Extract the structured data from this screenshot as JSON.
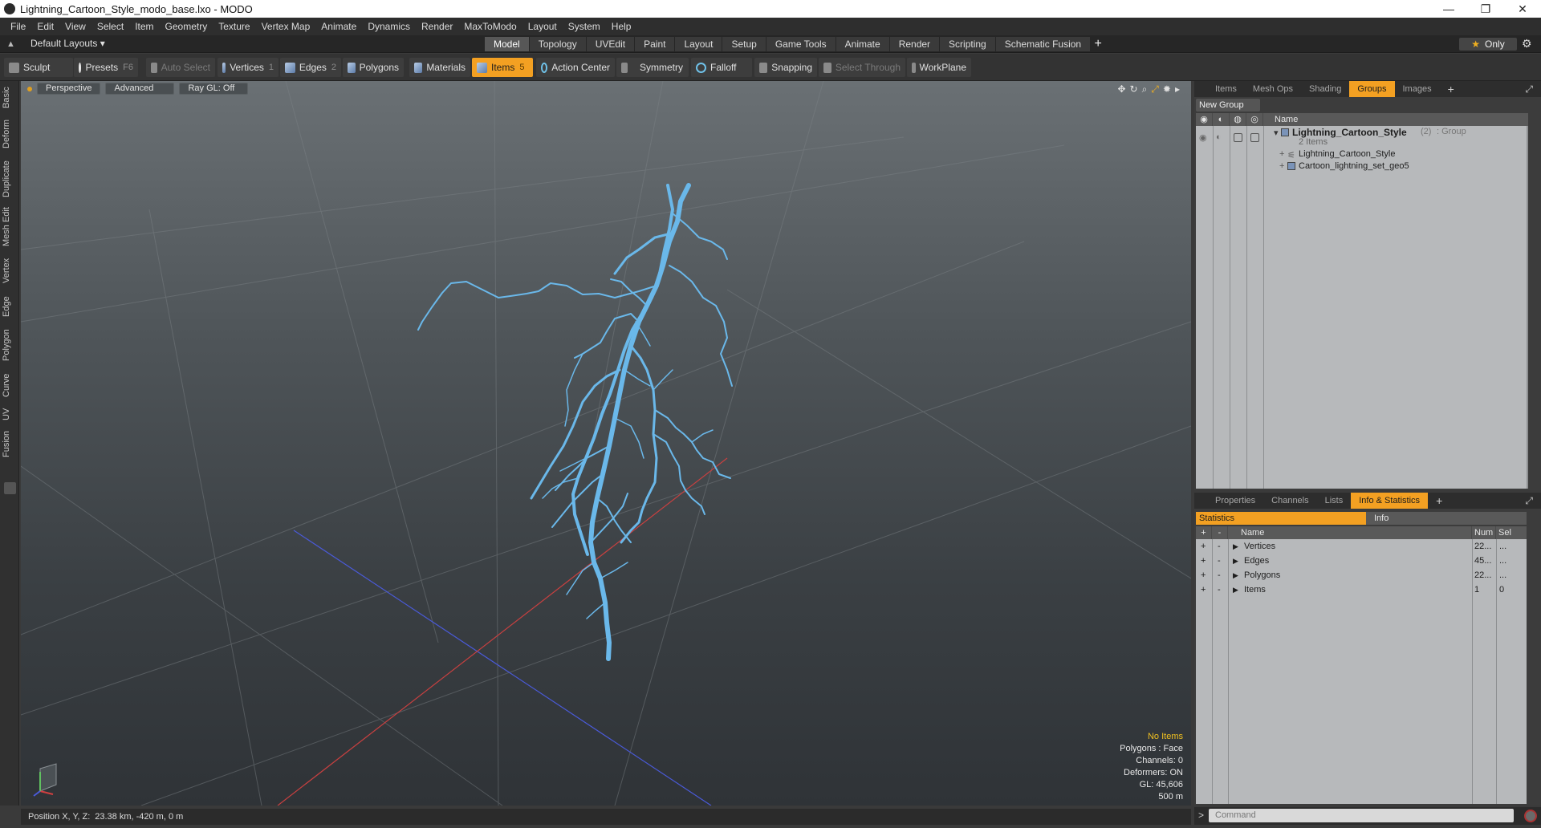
{
  "window": {
    "title": "Lightning_Cartoon_Style_modo_base.lxo - MODO",
    "minimize": "—",
    "maximize": "❐",
    "close": "✕"
  },
  "menu": [
    "File",
    "Edit",
    "View",
    "Select",
    "Item",
    "Geometry",
    "Texture",
    "Vertex Map",
    "Animate",
    "Dynamics",
    "Render",
    "MaxToModo",
    "Layout",
    "System",
    "Help"
  ],
  "layoutbar": {
    "layout_label": "Default Layouts ▾",
    "tabs": [
      "Model",
      "Topology",
      "UVEdit",
      "Paint",
      "Layout",
      "Setup",
      "Game Tools",
      "Animate",
      "Render",
      "Scripting",
      "Schematic Fusion"
    ],
    "active_tab": "Model",
    "plus": "+",
    "only_label": "Only",
    "star": "★",
    "gear": "⚙"
  },
  "toolbar": {
    "sculpt": "Sculpt",
    "presets": "Presets",
    "presets_key": "F6",
    "auto_select": "Auto Select",
    "vertices": "Vertices",
    "vertices_key": "1",
    "edges": "Edges",
    "edges_key": "2",
    "polygons": "Polygons",
    "materials": "Materials",
    "items": "Items",
    "items_key": "5",
    "action_center": "Action Center",
    "symmetry": "Symmetry",
    "falloff": "Falloff",
    "snapping": "Snapping",
    "select_through": "Select Through",
    "workplane": "WorkPlane"
  },
  "left_tabs": [
    "Basic",
    "Deform",
    "Duplicate",
    "Mesh Edit",
    "Vertex",
    "Edge",
    "Polygon",
    "Curve",
    "UV",
    "Fusion"
  ],
  "viewport": {
    "view_mode": "Perspective",
    "shading": "Advanced",
    "raygl": "Ray GL: Off",
    "info": {
      "no_items": "No Items",
      "polygons": "Polygons : Face",
      "channels": "Channels: 0",
      "deformers": "Deformers: ON",
      "gl": "GL: 45,606",
      "scale": "500 m"
    },
    "axis_colors": {
      "x": "#d04040",
      "y": "#60c060",
      "z": "#4a5ad8"
    },
    "bolt_color": "#6ab8ea"
  },
  "statusbar": {
    "label": "Position X, Y, Z:",
    "value": "23.38 km, -420 m, 0 m"
  },
  "groups_panel": {
    "tabs": [
      "Items",
      "Mesh Ops",
      "Shading",
      "Groups",
      "Images"
    ],
    "active_tab": "Groups",
    "plus": "+",
    "new_group": "New Group",
    "header_name": "Name",
    "group": {
      "name": "Lightning_Cartoon_Style",
      "count": "(2)",
      "type": ": Group",
      "items_count": "2 Items"
    },
    "children": [
      "Lightning_Cartoon_Style",
      "Cartoon_lightning_set_geo5"
    ]
  },
  "stats_panel": {
    "tabs": [
      "Properties",
      "Channels",
      "Lists",
      "Info & Statistics"
    ],
    "active_tab": "Info & Statistics",
    "plus": "+",
    "sub_tabs": [
      "Statistics",
      "Info"
    ],
    "headers": {
      "name": "Name",
      "num": "Num",
      "sel": "Sel"
    },
    "rows": [
      {
        "name": "Vertices",
        "num": "22...",
        "sel": "..."
      },
      {
        "name": "Edges",
        "num": "45...",
        "sel": "..."
      },
      {
        "name": "Polygons",
        "num": "22...",
        "sel": "..."
      },
      {
        "name": "Items",
        "num": "1",
        "sel": "0"
      }
    ]
  },
  "command": {
    "prompt": ">",
    "placeholder": "Command"
  }
}
